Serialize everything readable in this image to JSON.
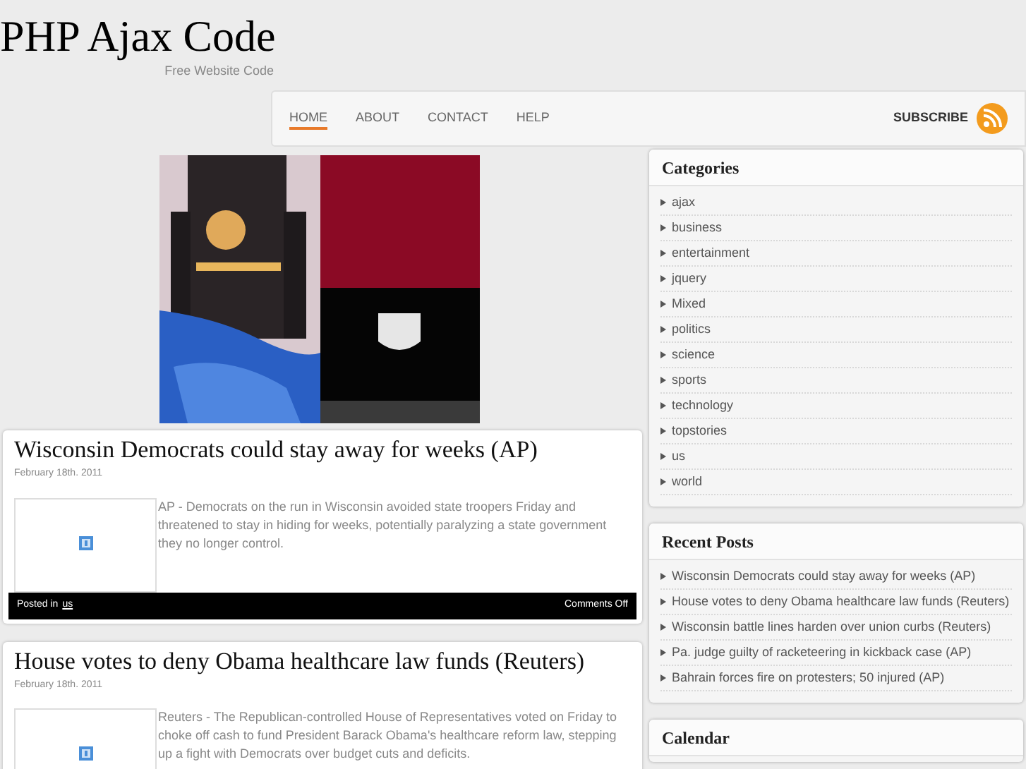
{
  "site": {
    "title": "PHP Ajax Code",
    "tagline": "Free Website Code"
  },
  "nav": {
    "items": [
      {
        "label": "HOME",
        "selected": true
      },
      {
        "label": "ABOUT",
        "selected": false
      },
      {
        "label": "CONTACT",
        "selected": false
      },
      {
        "label": "HELP",
        "selected": false
      }
    ],
    "subscribe": "SUBSCRIBE"
  },
  "posts": [
    {
      "title": "Wisconsin Democrats could stay away for weeks (AP)",
      "date": "February 18th. 2011",
      "excerpt": "AP - Democrats on the run in Wisconsin avoided state troopers Friday and threatened to stay in hiding for weeks, potentially paralyzing a state government they no longer control.",
      "posted_in": "Posted in",
      "category": "us",
      "comments": "Comments Off"
    },
    {
      "title": "House votes to deny Obama healthcare law funds (Reuters)",
      "date": "February 18th. 2011",
      "excerpt": "Reuters - The Republican-controlled House of Representatives voted on Friday to choke off cash to fund President Barack Obama's healthcare reform law, stepping up a fight with Democrats over budget cuts and deficits."
    }
  ],
  "sidebar": [
    {
      "title": "Categories",
      "items": [
        "ajax",
        "business",
        "entertainment",
        "jquery",
        "Mixed",
        "politics",
        "science",
        "sports",
        "technology",
        "topstories",
        "us",
        "world"
      ]
    },
    {
      "title": "Recent Posts",
      "items": [
        "Wisconsin Democrats could stay away for weeks (AP)",
        "House votes to deny Obama healthcare law funds (Reuters)",
        "Wisconsin battle lines harden over union curbs (Reuters)",
        "Pa. judge guilty of racketeering in kickback case (AP)",
        "Bahrain forces fire on protesters; 50 injured (AP)"
      ]
    },
    {
      "title": "Calendar"
    }
  ]
}
